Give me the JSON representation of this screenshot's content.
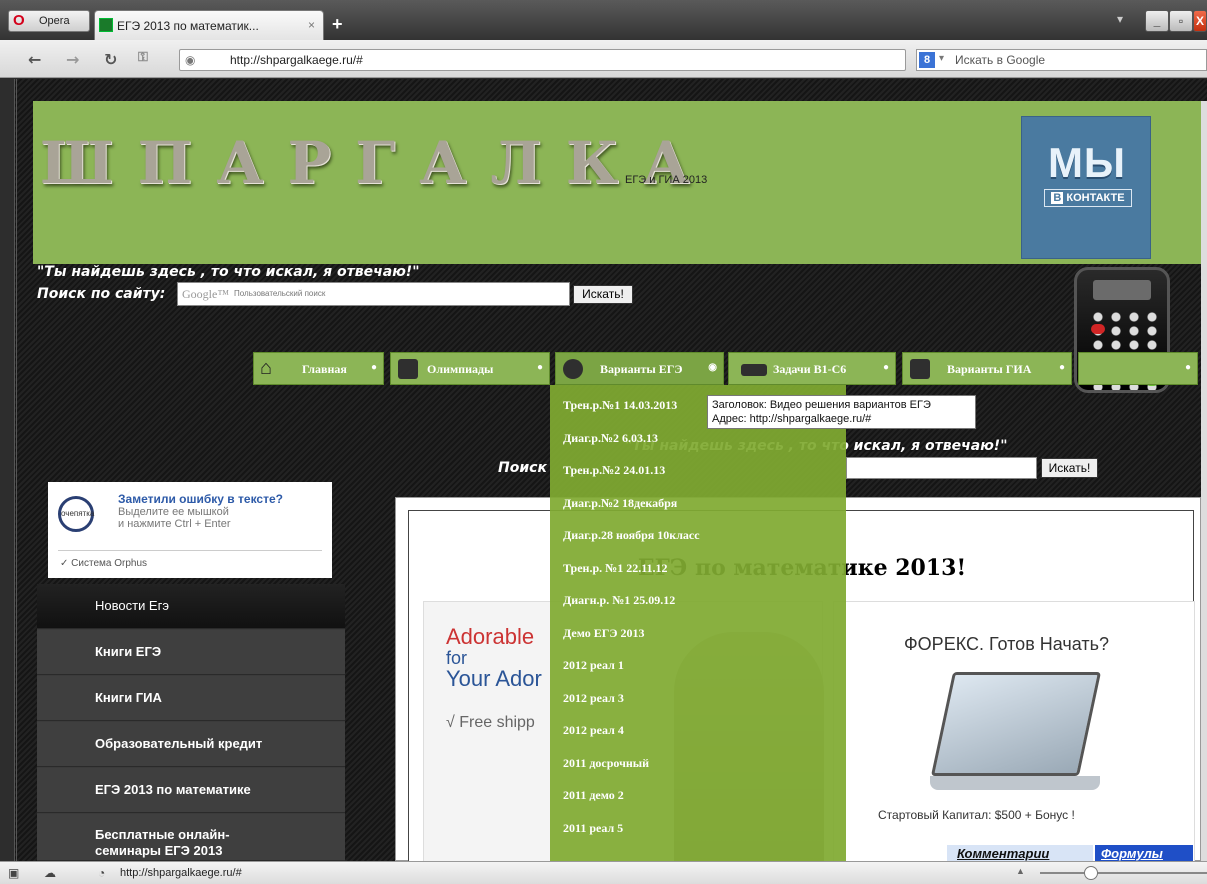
{
  "browser": {
    "menu_label": "Opera",
    "tab_title": "ЕГЭ 2013 по математик...",
    "tab_close": "×",
    "new_tab": "+",
    "url": "http://shpargalkaege.ru/#",
    "search_placeholder": "Искать в Google",
    "search_engine": "8",
    "status_url": "http://shpargalkaege.ru/#"
  },
  "header": {
    "logo": "ШПАРГАЛКА",
    "subtitle": "ЕГЭ и ГИА 2013",
    "vk_big": "МЫ",
    "vk_small_b": "В",
    "vk_small": "КОНТАКТЕ",
    "bg_color": "#8cb556"
  },
  "slogan": "\"Ты найдешь здесь , то что искал, я отвечаю!\"",
  "site_search": {
    "label": "Поиск по сайту:",
    "google_logo": "Google™",
    "placeholder": "Пользовательский поиск",
    "button": "Искать!"
  },
  "menu": {
    "items": [
      {
        "label": "Главная",
        "dot": "●"
      },
      {
        "label": "Олимпиады",
        "dot": "●"
      },
      {
        "label": "Варианты ЕГЭ",
        "dot": "◉"
      },
      {
        "label": "Задачи В1-С6",
        "dot": "●"
      },
      {
        "label": "Варианты ГИА",
        "dot": "●"
      },
      {
        "label": "",
        "dot": "●"
      }
    ]
  },
  "dropdown": [
    "Трен.р.№1 14.03.2013",
    "Диаг.р.№2 6.03.13",
    "Трен.р.№2 24.01.13",
    "Диаг.р.№2 18декабря",
    "Диаг.р.28 ноября 10класс",
    "Трен.р. №1 22.11.12",
    "Диагн.р. №1 25.09.12",
    "Демо ЕГЭ 2013",
    "2012 реал 1",
    "2012 реал 3",
    "2012 реал 4",
    "2011 досрочный",
    "2011 демо 2",
    "2011 реал 5"
  ],
  "tooltip": {
    "line1": "Заголовок: Видео решения вариантов ЕГЭ",
    "line2": "Адрес: http://shpargalkaege.ru/#"
  },
  "slogan2": "\"Ты найдешь здесь , то что искал, я отвечаю!\"",
  "search2_label": "Поиск",
  "search2_button": "Искать!",
  "orphus": {
    "title": "Заметили ошибку в тексте?",
    "line1": "Выделите ее мышкой",
    "line2": "и нажмите Ctrl + Enter",
    "badge": "очепятка",
    "footer": "Система Orphus"
  },
  "sidebar": [
    "Новости Егэ",
    "Книги ЕГЭ",
    "Книги ГИА",
    "Образовательный кредит",
    "ЕГЭ 2013 по математике",
    "Бесплатные онлайн-семинары ЕГЭ 2013"
  ],
  "content": {
    "title": "ЕГЭ по математике 2013!",
    "ad1": {
      "line1": "Adorable",
      "line2": "for",
      "line3": "Your Ador",
      "line4": "√ Free shipp"
    },
    "ad2": {
      "headline": "ФОРЕКС. Готов Начать?",
      "caption": "Стартовый Капитал: $500 + Бонус !"
    },
    "tag1": "Комментарии",
    "tag2": "Формулы"
  }
}
